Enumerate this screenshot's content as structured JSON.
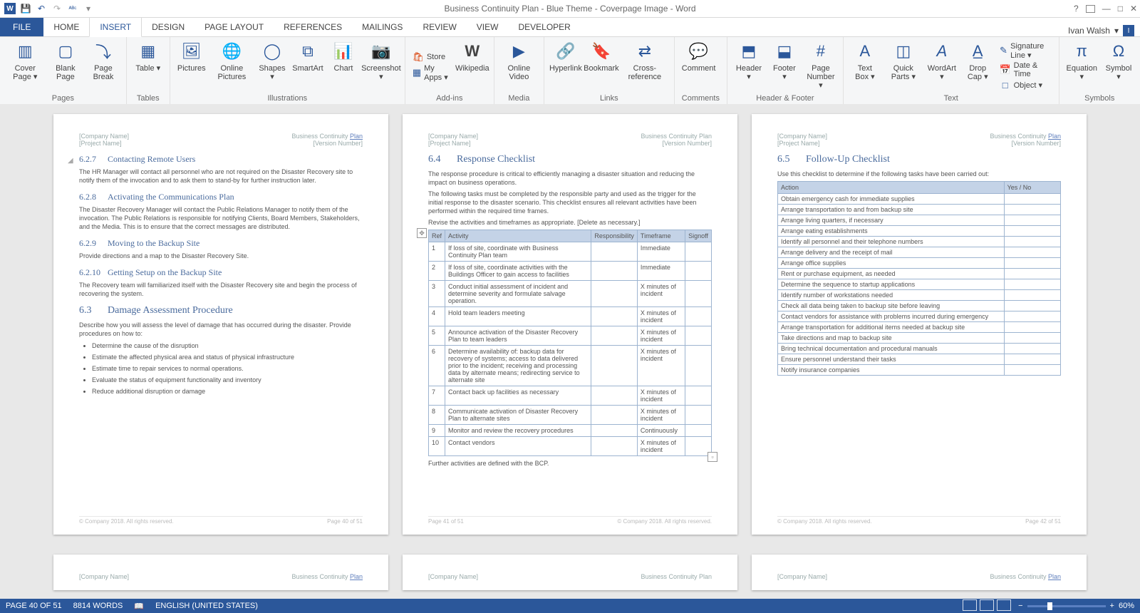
{
  "window": {
    "title": "Business Continuity Plan - Blue Theme - Coverpage Image - Word",
    "user": "Ivan Walsh",
    "user_initial": "I"
  },
  "tabs": {
    "file": "FILE",
    "list": [
      "HOME",
      "INSERT",
      "DESIGN",
      "PAGE LAYOUT",
      "REFERENCES",
      "MAILINGS",
      "REVIEW",
      "VIEW",
      "DEVELOPER"
    ],
    "active": "INSERT"
  },
  "ribbon": {
    "groups": {
      "pages": {
        "label": "Pages",
        "items": [
          "Cover Page ▾",
          "Blank Page",
          "Page Break"
        ]
      },
      "tables": {
        "label": "Tables",
        "items": [
          "Table ▾"
        ]
      },
      "illustrations": {
        "label": "Illustrations",
        "items": [
          "Pictures",
          "Online Pictures",
          "Shapes ▾",
          "SmartArt",
          "Chart",
          "Screenshot ▾"
        ]
      },
      "apps": {
        "label": "Add-ins",
        "store": "Store",
        "myapps": "My Apps ▾",
        "wiki": "Wikipedia"
      },
      "media": {
        "label": "Media",
        "items": [
          "Online Video"
        ]
      },
      "links": {
        "label": "Links",
        "items": [
          "Hyperlink",
          "Bookmark",
          "Cross-reference"
        ]
      },
      "comments": {
        "label": "Comments",
        "items": [
          "Comment"
        ]
      },
      "hf": {
        "label": "Header & Footer",
        "items": [
          "Header ▾",
          "Footer ▾",
          "Page Number ▾"
        ]
      },
      "text": {
        "label": "Text",
        "items": [
          "Text Box ▾",
          "Quick Parts ▾",
          "WordArt ▾",
          "Drop Cap ▾"
        ],
        "side": [
          "Signature Line ▾",
          "Date & Time",
          "Object ▾"
        ]
      },
      "symbols": {
        "label": "Symbols",
        "items": [
          "Equation ▾",
          "Symbol ▾"
        ]
      }
    }
  },
  "doc_header": {
    "company": "[Company Name]",
    "project": "[Project Name]",
    "doc_title": "Business Continuity ",
    "plan_link": "Plan",
    "version": "[Version Number]"
  },
  "page40": {
    "s1_num": "6.2.7",
    "s1_title": "Contacting Remote Users",
    "s1_body": "The HR Manager will contact all personnel who are not required on the Disaster Recovery site to notify them of the invocation and to ask them to stand-by for further instruction later.",
    "s2_num": "6.2.8",
    "s2_title": "Activating the Communications Plan",
    "s2_body": "The Disaster Recovery Manager will contact the Public Relations Manager to notify them of the invocation. The Public Relations is responsible for notifying Clients, Board Members, Stakeholders, and the Media. This is to ensure that the correct messages are distributed.",
    "s3_num": "6.2.9",
    "s3_title": "Moving to the Backup Site",
    "s3_body": "Provide directions and a map to the Disaster Recovery Site.",
    "s4_num": "6.2.10",
    "s4_title": "Getting Setup on the Backup Site",
    "s4_body": "The Recovery team will familiarized itself with the Disaster Recovery site and begin the process of recovering the system.",
    "s5_num": "6.3",
    "s5_title": "Damage Assessment Procedure",
    "s5_body": "Describe how you will assess the level of damage that has occurred during the disaster. Provide procedures on how to:",
    "bullets": [
      "Determine the cause of the disruption",
      "Estimate the affected physical area and status of physical infrastructure",
      "Estimate time to repair services to normal operations.",
      "Evaluate the status of equipment functionality and inventory",
      "Reduce additional disruption or damage"
    ],
    "footer_left": "© Company 2018. All rights reserved.",
    "footer_right": "Page 40 of 51"
  },
  "page41": {
    "s1_num": "6.4",
    "s1_title": "Response Checklist",
    "p1": "The response procedure is critical to efficiently managing a disaster situation and reducing the impact on business operations.",
    "p2": "The following tasks must be completed by the responsible party and used as the trigger for the initial response to the disaster scenario. This checklist ensures all relevant activities have been performed within the required time frames.",
    "p3": "Revise the activities and timeframes as appropriate. [Delete as necessary.]",
    "table_head": [
      "Ref",
      "Activity",
      "Responsibility",
      "Timeframe",
      "Signoff"
    ],
    "rows": [
      {
        "ref": "1",
        "act": "If loss of site, coordinate with Business Continuity Plan team",
        "resp": "",
        "time": "Immediate",
        "sign": ""
      },
      {
        "ref": "2",
        "act": "If loss of site, coordinate activities with the Buildings Officer to gain access to facilities",
        "resp": "",
        "time": "Immediate",
        "sign": ""
      },
      {
        "ref": "3",
        "act": "Conduct initial assessment of incident and determine severity and formulate salvage operation.",
        "resp": "",
        "time": "X minutes of incident",
        "sign": ""
      },
      {
        "ref": "4",
        "act": "Hold team leaders meeting",
        "resp": "",
        "time": "X minutes of incident",
        "sign": ""
      },
      {
        "ref": "5",
        "act": "Announce activation of the Disaster Recovery Plan to team leaders",
        "resp": "",
        "time": "X minutes of incident",
        "sign": ""
      },
      {
        "ref": "6",
        "act": "Determine availability of: backup data for recovery of systems; access to data delivered prior to the incident; receiving and processing data by alternate means; redirecting service to alternate site",
        "resp": "",
        "time": "X minutes of incident",
        "sign": ""
      },
      {
        "ref": "7",
        "act": "Contact back up facilities as necessary",
        "resp": "",
        "time": "X minutes of incident",
        "sign": ""
      },
      {
        "ref": "8",
        "act": "Communicate activation of Disaster Recovery Plan to alternate sites",
        "resp": "",
        "time": "X minutes of incident",
        "sign": ""
      },
      {
        "ref": "9",
        "act": "Monitor and review the recovery procedures",
        "resp": "",
        "time": "Continuously",
        "sign": ""
      },
      {
        "ref": "10",
        "act": "Contact vendors",
        "resp": "",
        "time": "X minutes of incident",
        "sign": ""
      }
    ],
    "after": "Further activities are defined with the BCP.",
    "footer_left": "Page 41 of 51",
    "footer_right": "© Company 2018. All rights reserved."
  },
  "page42": {
    "s1_num": "6.5",
    "s1_title": "Follow-Up Checklist",
    "p1": "Use this checklist to determine if the following tasks have been carried out:",
    "table_head": [
      "Action",
      "Yes / No"
    ],
    "rows": [
      "Obtain emergency cash for immediate supplies",
      "Arrange transportation to and from backup site",
      "Arrange living quarters, if necessary",
      "Arrange eating establishments",
      "Identify all personnel and their telephone numbers",
      "Arrange delivery and the receipt of mail",
      "Arrange office supplies",
      "Rent or purchase equipment, as needed",
      "Determine the sequence to startup applications",
      "Identify number of workstations needed",
      "Check all data being taken to backup site before leaving",
      "Contact vendors for assistance with problems incurred during emergency",
      "Arrange transportation for additional items needed at backup site",
      "Take directions and map to backup site",
      "Bring technical documentation and procedural manuals",
      "Ensure personnel understand their tasks",
      "Notify insurance companies"
    ],
    "footer_left": "© Company 2018. All rights reserved.",
    "footer_right": "Page 42 of 51"
  },
  "status": {
    "page": "PAGE 40 OF 51",
    "words": "8814 WORDS",
    "lang": "ENGLISH (UNITED STATES)",
    "zoom": "60%"
  }
}
